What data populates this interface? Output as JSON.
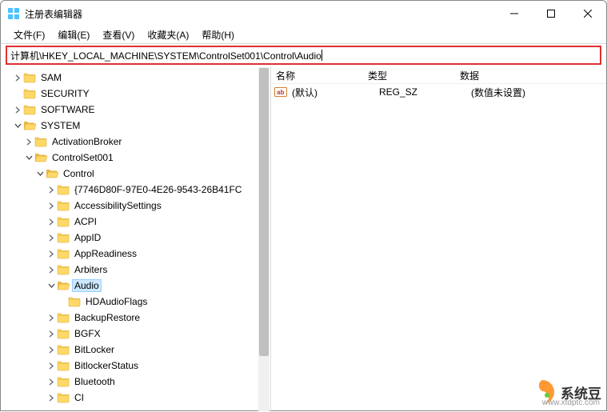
{
  "window": {
    "title": "注册表编辑器"
  },
  "menu": {
    "file": "文件(F)",
    "edit": "编辑(E)",
    "view": "查看(V)",
    "favorites": "收藏夹(A)",
    "help": "帮助(H)"
  },
  "address": {
    "path": "计算机\\HKEY_LOCAL_MACHINE\\SYSTEM\\ControlSet001\\Control\\Audio"
  },
  "tree": {
    "sam": "SAM",
    "security": "SECURITY",
    "software": "SOFTWARE",
    "system": "SYSTEM",
    "activationbroker": "ActivationBroker",
    "controlset001": "ControlSet001",
    "control": "Control",
    "guidkey": "{7746D80F-97E0-4E26-9543-26B41FC",
    "accessibilitysettings": "AccessibilitySettings",
    "acpi": "ACPI",
    "appid": "AppID",
    "appreadiness": "AppReadiness",
    "arbiters": "Arbiters",
    "audio": "Audio",
    "hdaudioflags": "HDAudioFlags",
    "backuprestore": "BackupRestore",
    "bgfx": "BGFX",
    "bitlocker": "BitLocker",
    "bitlockerstatus": "BitlockerStatus",
    "bluetooth": "Bluetooth",
    "ci": "CI"
  },
  "list": {
    "headers": {
      "name": "名称",
      "type": "类型",
      "data": "数据"
    },
    "row0": {
      "name": "(默认)",
      "type": "REG_SZ",
      "data": "(数值未设置)"
    }
  },
  "watermark": {
    "text": "系统豆",
    "url": "www.xtdptc.com"
  }
}
